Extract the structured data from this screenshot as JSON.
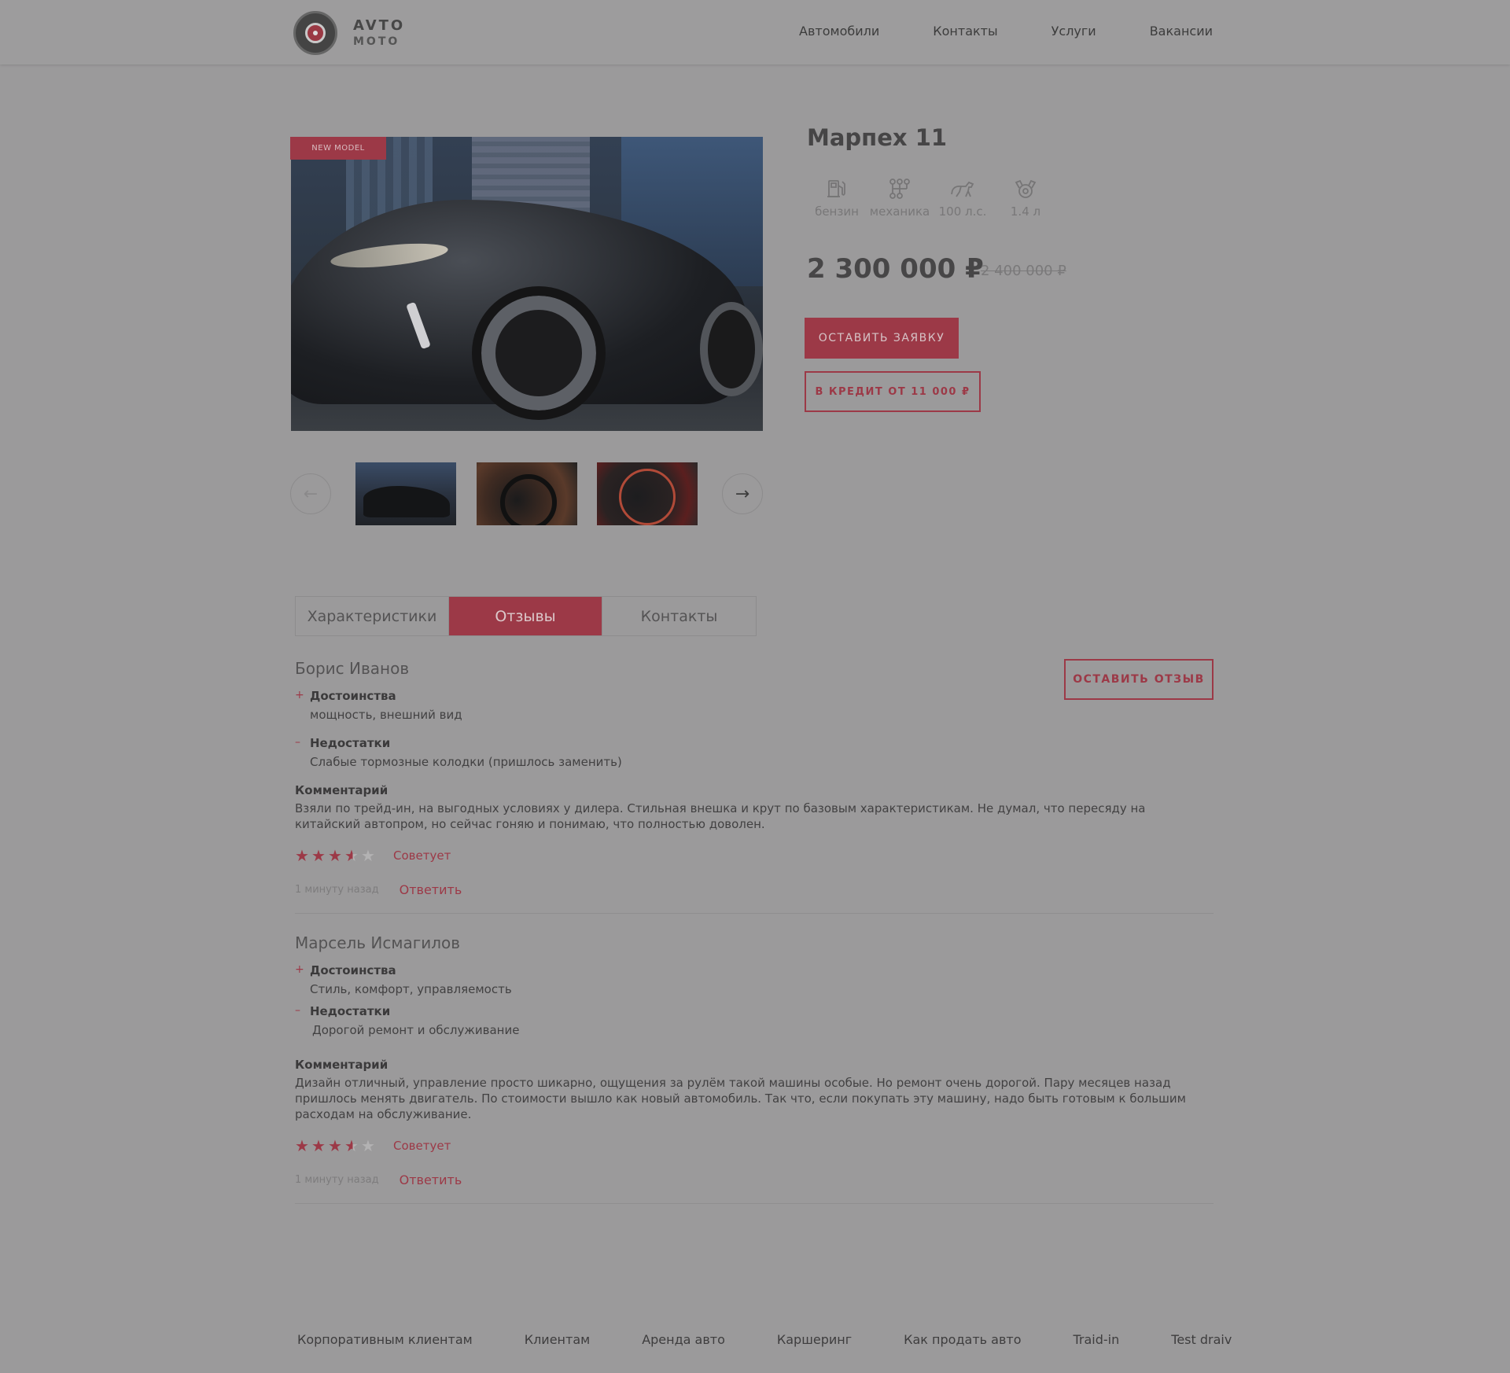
{
  "header": {
    "logo_line1": "AVTO",
    "logo_line2": "MOTO",
    "nav": [
      "Автомобили",
      "Контакты",
      "Услуги",
      "Вакансии"
    ]
  },
  "product": {
    "badge": "NEW MODEL",
    "title": "Марпех 11",
    "specs": [
      {
        "icon": "fuel-icon",
        "label": "бензин"
      },
      {
        "icon": "gearbox-icon",
        "label": "механика"
      },
      {
        "icon": "horse-icon",
        "label": "100 л.с."
      },
      {
        "icon": "engine-icon",
        "label": "1.4 л"
      }
    ],
    "price": "2 300 000 ₽",
    "old_price": "2 400 000 ₽",
    "order_button": "ОСТАВИТЬ ЗАЯВКУ",
    "credit_button": "В КРЕДИТ ОТ 11 000 ₽",
    "gallery_prev": "←",
    "gallery_next": "→"
  },
  "tabs": {
    "items": [
      "Характеристики",
      "Отзывы",
      "Контакты"
    ],
    "active": "Отзывы"
  },
  "reviews": {
    "leave_review_button": "ОСТАВИТЬ ОТЗЫВ",
    "items": [
      {
        "name": "Борис Иванов",
        "pros_sign": "+",
        "pros_label": "Достоинства",
        "pros": "мощность, внешний вид",
        "cons_sign": "–",
        "cons_label": "Недостатки",
        "cons": "Слабые тормозные колодки (пришлось заменить)",
        "comment_label": "Комментарий",
        "comment": "Взяли по трейд-ин, на выгодных условиях у дилера. Стильная внешка и крут по базовым характеристикам. Не думал, что пересяду на китайский автопром, но сейчас гоняю и понимаю, что полностью доволен.",
        "rating": 3.5,
        "recommend": "Советует",
        "time": "1 минуту назад",
        "reply": "Ответить"
      },
      {
        "name": "Марсель Исмагилов",
        "pros_sign": "+",
        "pros_label": "Достоинства",
        "pros": "Стиль, комфорт, управляемость",
        "cons_sign": "–",
        "cons_label": "Недостатки",
        "cons": "Дорогой ремонт и обслуживание",
        "comment_label": "Комментарий",
        "comment": "Дизайн отличный, управление просто шикарно, ощущения за рулём такой машины особые. Но ремонт очень дорогой. Пару месяцев назад пришлось менять двигатель. По стоимости вышло как новый автомобиль. Так что, если покупать эту машину, надо быть готовым к большим расходам на обслуживание.",
        "rating": 3.5,
        "recommend": "Советует",
        "time": "1 минуту назад",
        "reply": "Ответить"
      }
    ]
  },
  "footer": {
    "links": [
      "Корпоративным клиентам",
      "Клиентам",
      "Аренда авто",
      "Каршеринг",
      "Как продать авто",
      "Traid-in",
      "Test draiv"
    ]
  },
  "colors": {
    "accent": "#9c3947",
    "overlay_background": "#9b9a9b"
  }
}
